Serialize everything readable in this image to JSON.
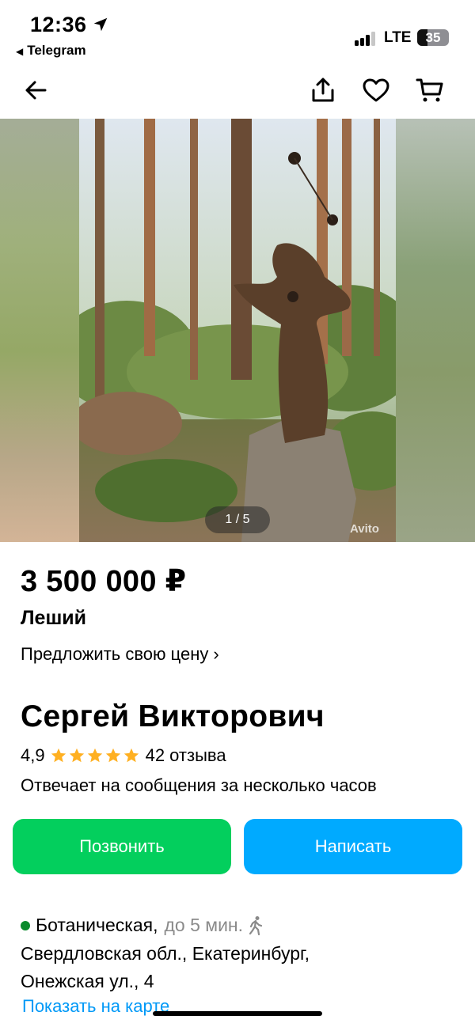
{
  "status_bar": {
    "time": "12:36",
    "back_app": "Telegram",
    "network": "LTE",
    "battery": "35",
    "icons": [
      "location-arrow-icon",
      "signal-icon",
      "battery-icon"
    ]
  },
  "nav": {
    "icons": [
      "back-arrow-icon",
      "share-icon",
      "favorite-heart-icon",
      "cart-icon"
    ]
  },
  "gallery": {
    "counter": "1 / 5",
    "watermark": "Avito"
  },
  "listing": {
    "price": "3 500 000 ₽",
    "title": "Леший",
    "offer_price_link": "Предложить свою цену"
  },
  "seller": {
    "name": "Сергей Викторович",
    "rating": "4,9",
    "stars": 5,
    "reviews": "42 отзыва",
    "response_time": "Отвечает на сообщения за несколько часов"
  },
  "actions": {
    "call": "Позвонить",
    "write": "Написать"
  },
  "location": {
    "metro": "Ботаническая,",
    "distance": "до 5 мин.",
    "address_line1": "Свердловская обл., Екатеринбург,",
    "address_line2": "Онежская ул., 4",
    "map_link": "Показать на карте"
  },
  "colors": {
    "call_button": "#03cf5d",
    "write_button": "#00aaff",
    "star": "#ffb021",
    "metro_dot": "#0b8a2d",
    "link": "#0099f7"
  }
}
